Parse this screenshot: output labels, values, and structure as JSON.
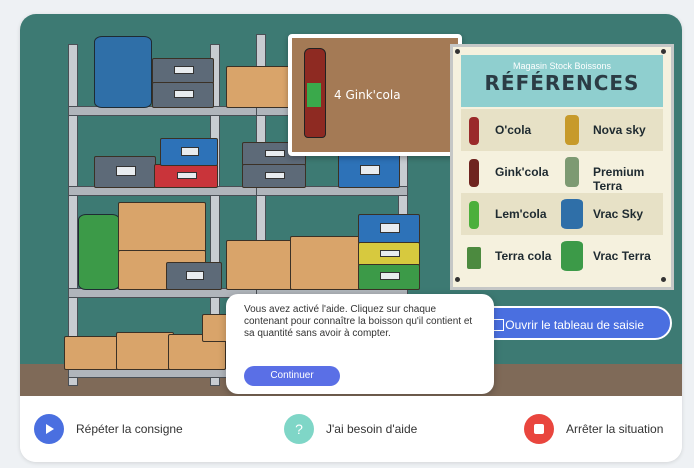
{
  "popup": {
    "product": "4 Gink'cola",
    "bottle_label": "Gink Cola"
  },
  "board": {
    "store": "Magasin Stock Boissons",
    "title": "RÉFÉRENCES",
    "left": [
      {
        "label": "O'cola",
        "icon": "red-bottle-icon"
      },
      {
        "label": "Gink'cola",
        "icon": "dark-red-bottle-icon"
      },
      {
        "label": "Lem'cola",
        "icon": "green-bottle-icon"
      },
      {
        "label": "Terra cola",
        "icon": "can-icon"
      }
    ],
    "right": [
      {
        "label": "Nova sky",
        "icon": "yellow-bottle-icon"
      },
      {
        "label": "Premium Terra",
        "icon": "premium-bottle-icon"
      },
      {
        "label": "Vrac Sky",
        "icon": "blue-drum-icon"
      },
      {
        "label": "Vrac Terra",
        "icon": "green-drum-icon"
      }
    ]
  },
  "open_table": "Ouvrir le tableau de saisie",
  "dialog": {
    "message": "Vous avez activé l'aide. Cliquez sur chaque contenant pour connaître la boisson qu'il contient et sa quantité sans avoir à compter.",
    "continue": "Continuer"
  },
  "bottom": {
    "repeat": "Répéter la consigne",
    "help": "J'ai besoin d'aide",
    "help_symbol": "?",
    "stop": "Arrêter la situation"
  },
  "colors": {
    "accent": "#4a6fe0",
    "help": "#7fd6c7",
    "stop": "#e9463e",
    "scene": "#3d7a73"
  }
}
